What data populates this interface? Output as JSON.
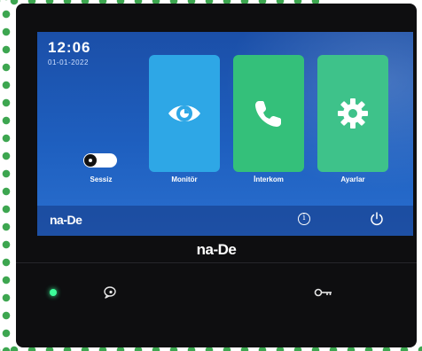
{
  "screen": {
    "time": "12:06",
    "date": "01-01-2022",
    "logo": "na-De",
    "mute_toggle": {
      "label": "Sessiz",
      "on": false
    },
    "tiles": [
      {
        "label": "Monitör",
        "icon": "eye-icon",
        "color": "#2ea7e6"
      },
      {
        "label": "İnterkom",
        "icon": "phone-icon",
        "color": "#34c07a"
      },
      {
        "label": "Ayarlar",
        "icon": "gear-icon",
        "color": "#3ec28a"
      }
    ],
    "bottom_bar": {
      "info_icon": "i",
      "power_icon": "power-icon"
    }
  },
  "device": {
    "brand": "na-De",
    "led_color": "#3cff9a",
    "buttons": [
      "talk-unlock-icon",
      "key-icon"
    ]
  }
}
